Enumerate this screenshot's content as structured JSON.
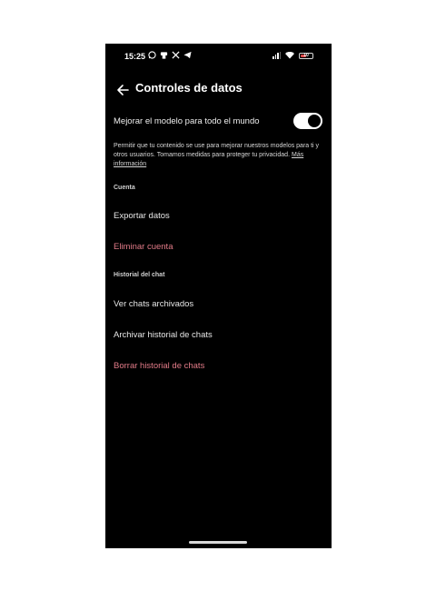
{
  "status_bar": {
    "time": "15:25",
    "notification_icons": [
      "whatsapp-icon",
      "notification-icon",
      "x-icon",
      "telegram-icon"
    ],
    "battery_level": "10",
    "battery_color": "#e04b4b"
  },
  "header": {
    "title": "Controles de datos"
  },
  "model_toggle": {
    "label": "Mejorar el modelo para todo el mundo",
    "enabled": true
  },
  "description": {
    "text": " Permitir que tu contenido se use para mejorar nuestros modelos para ti y otros usuarios. Tomamos medidas para proteger tu privacidad.",
    "link_text": "Más información"
  },
  "account_section": {
    "header": "Cuenta",
    "export_label": "Exportar datos",
    "delete_label": "Eliminar cuenta"
  },
  "chat_history_section": {
    "header": "Historial del chat",
    "archived_label": "Ver chats archivados",
    "archive_label": "Archivar historial de chats",
    "clear_label": "Borrar historial de chats"
  },
  "colors": {
    "background": "#000000",
    "text": "#e6e6e6",
    "danger": "#e27b88"
  }
}
